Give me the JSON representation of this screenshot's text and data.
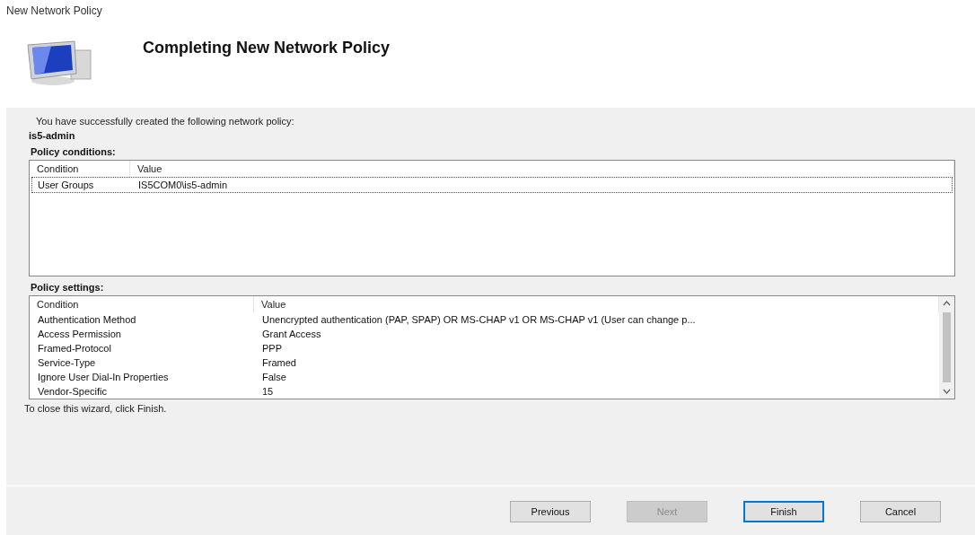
{
  "window": {
    "title": "New Network Policy"
  },
  "header": {
    "title": "Completing New Network Policy"
  },
  "intro": "You have successfully created the following network policy:",
  "policy_name": "is5-admin",
  "conditions": {
    "label": "Policy conditions:",
    "columns": [
      "Condition",
      "Value"
    ],
    "rows": [
      {
        "cells": [
          "User Groups",
          "IS5COM0\\is5-admin"
        ],
        "selected": true
      }
    ]
  },
  "settings": {
    "label": "Policy settings:",
    "columns": [
      "Condition",
      "Value"
    ],
    "rows": [
      {
        "cells": [
          "Authentication Method",
          "Unencrypted authentication (PAP, SPAP) OR MS-CHAP v1 OR MS-CHAP v1 (User can change p..."
        ]
      },
      {
        "cells": [
          "Access Permission",
          "Grant Access"
        ]
      },
      {
        "cells": [
          "Framed-Protocol",
          "PPP"
        ]
      },
      {
        "cells": [
          "Service-Type",
          "Framed"
        ]
      },
      {
        "cells": [
          "Ignore User Dial-In Properties",
          "False"
        ]
      },
      {
        "cells": [
          "Vendor-Specific",
          "15"
        ]
      }
    ]
  },
  "footer_note": "To close this wizard, click Finish.",
  "buttons": [
    {
      "label": "Previous",
      "disabled": false,
      "default": false
    },
    {
      "label": "Next",
      "disabled": true,
      "default": false
    },
    {
      "label": "Finish",
      "disabled": false,
      "default": true
    },
    {
      "label": "Cancel",
      "disabled": false,
      "default": false
    }
  ]
}
